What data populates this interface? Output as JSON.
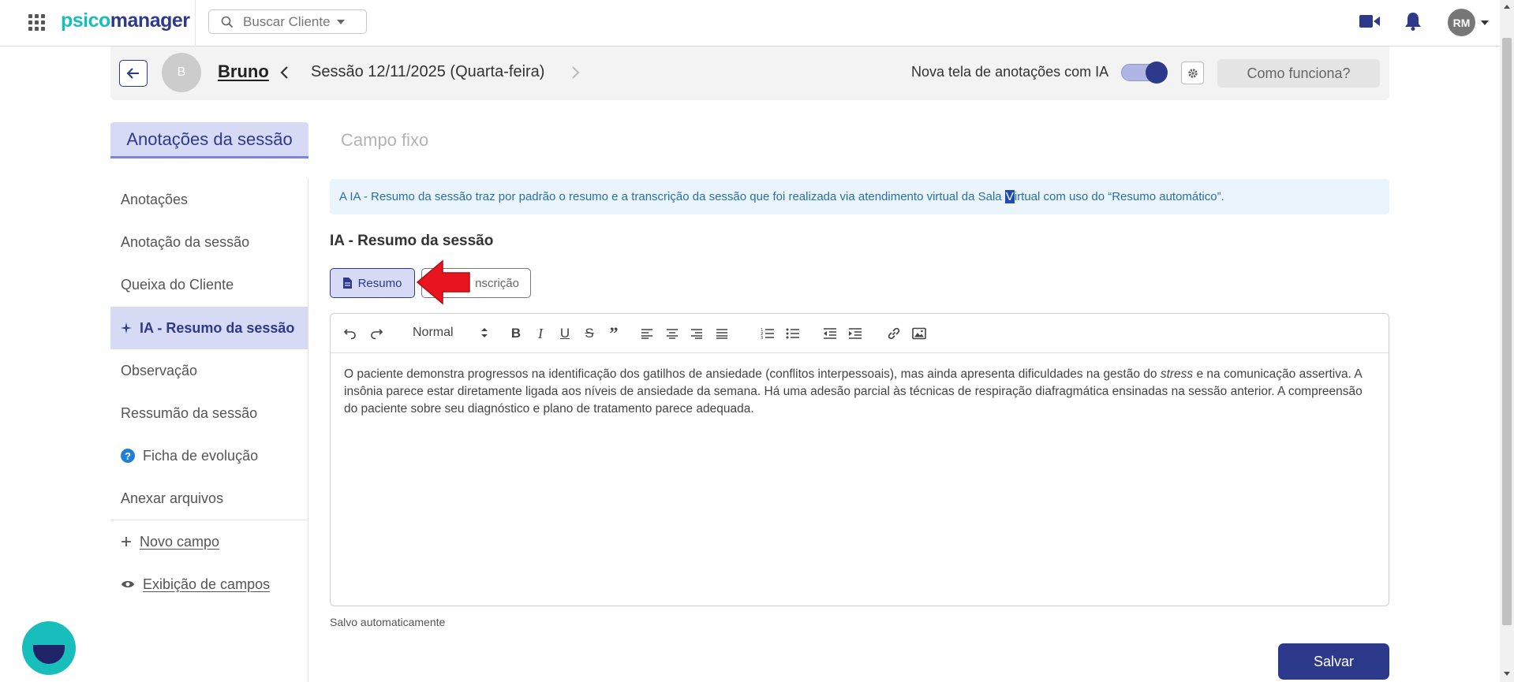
{
  "topbar": {
    "logo_part1": "psico",
    "logo_part2": "manager",
    "search_placeholder": "Buscar Cliente",
    "user_initials": "RM"
  },
  "session": {
    "patient_initial": "B",
    "patient_name": "Bruno",
    "title": "Sessão 12/11/2025 (Quarta-feira)",
    "ai_toggle_label": "Nova tela de anotações com IA",
    "ai_toggle_on": true,
    "how_button": "Como funciona?"
  },
  "tabs": [
    {
      "label": "Anotações da sessão",
      "active": true
    },
    {
      "label": "Campo fixo",
      "active": false
    }
  ],
  "sidebar": {
    "items": [
      {
        "label": "Anotações"
      },
      {
        "label": "Anotação da sessão"
      },
      {
        "label": "Queixa do Cliente"
      },
      {
        "label": "IA - Resumo da sessão",
        "active": true
      },
      {
        "label": "Observação"
      },
      {
        "label": "Ressumão da sessão"
      },
      {
        "label": "Ficha de evolução",
        "icon": "help-icon",
        "icon_text": "?"
      },
      {
        "label": "Anexar arquivos"
      }
    ],
    "new_field": "Novo campo",
    "show_fields": "Exibição de campos"
  },
  "main": {
    "info_pre": "A IA - Resumo da sessão traz por padrão o resumo e a transcrição da sessão que foi realizada via atendimento virtual da Sala ",
    "info_hl": "V",
    "info_post": "irtual com uso do “Resumo automático”.",
    "section_title": "IA - Resumo da sessão",
    "btn_resumo": "Resumo",
    "btn_transcricao": "nscrição",
    "editor": {
      "format_select": "Normal",
      "text_part1": "O paciente demonstra progressos na identificação dos gatilhos de ansiedade (conflitos interpessoais), mas ainda apresenta dificuldades na gestão do ",
      "text_em": "stress",
      "text_part2": " e na comunicação assertiva. A insônia parece estar diretamente ligada aos níveis de ansiedade da semana. Há uma adesão parcial às técnicas de respiração diafragmática ensinadas na sessão anterior. A compreensão do paciente sobre seu diagnóstico e plano de tratamento parece adequada."
    },
    "saved_note": "Salvo automaticamente",
    "save_button": "Salvar"
  },
  "colors": {
    "brand_primary": "#2d3a8c",
    "brand_accent": "#17bebb",
    "active_bg": "#d6daf5",
    "info_bg": "#eaf4fd",
    "annotation_arrow": "#e8141e"
  }
}
